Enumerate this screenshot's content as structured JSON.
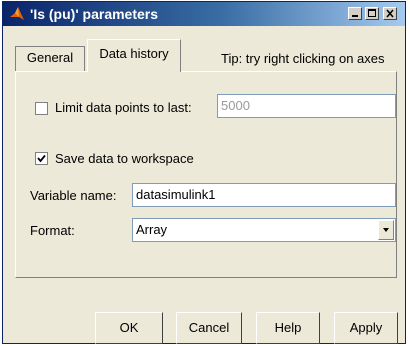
{
  "window": {
    "title": "'Is (pu)' parameters"
  },
  "tabs": [
    {
      "label": "General"
    },
    {
      "label": "Data history"
    }
  ],
  "tip": "Tip: try right clicking on axes",
  "limit": {
    "label": "Limit data points to last:",
    "value": "5000",
    "checked": false
  },
  "save": {
    "label": "Save data to workspace",
    "checked": true
  },
  "variable": {
    "label": "Variable name:",
    "value": "datasimulink1"
  },
  "format": {
    "label": "Format:",
    "value": "Array"
  },
  "buttons": {
    "ok": "OK",
    "cancel": "Cancel",
    "help": "Help",
    "apply": "Apply"
  },
  "icons": {
    "app": "matlab-icon",
    "minimize": "minimize-icon",
    "maximize": "maximize-icon",
    "close": "close-icon",
    "dropdown": "chevron-down-icon"
  },
  "colors": {
    "titlebar_start": "#0a246a",
    "titlebar_end": "#a6caf0",
    "dialog_bg": "#ece9d8"
  }
}
